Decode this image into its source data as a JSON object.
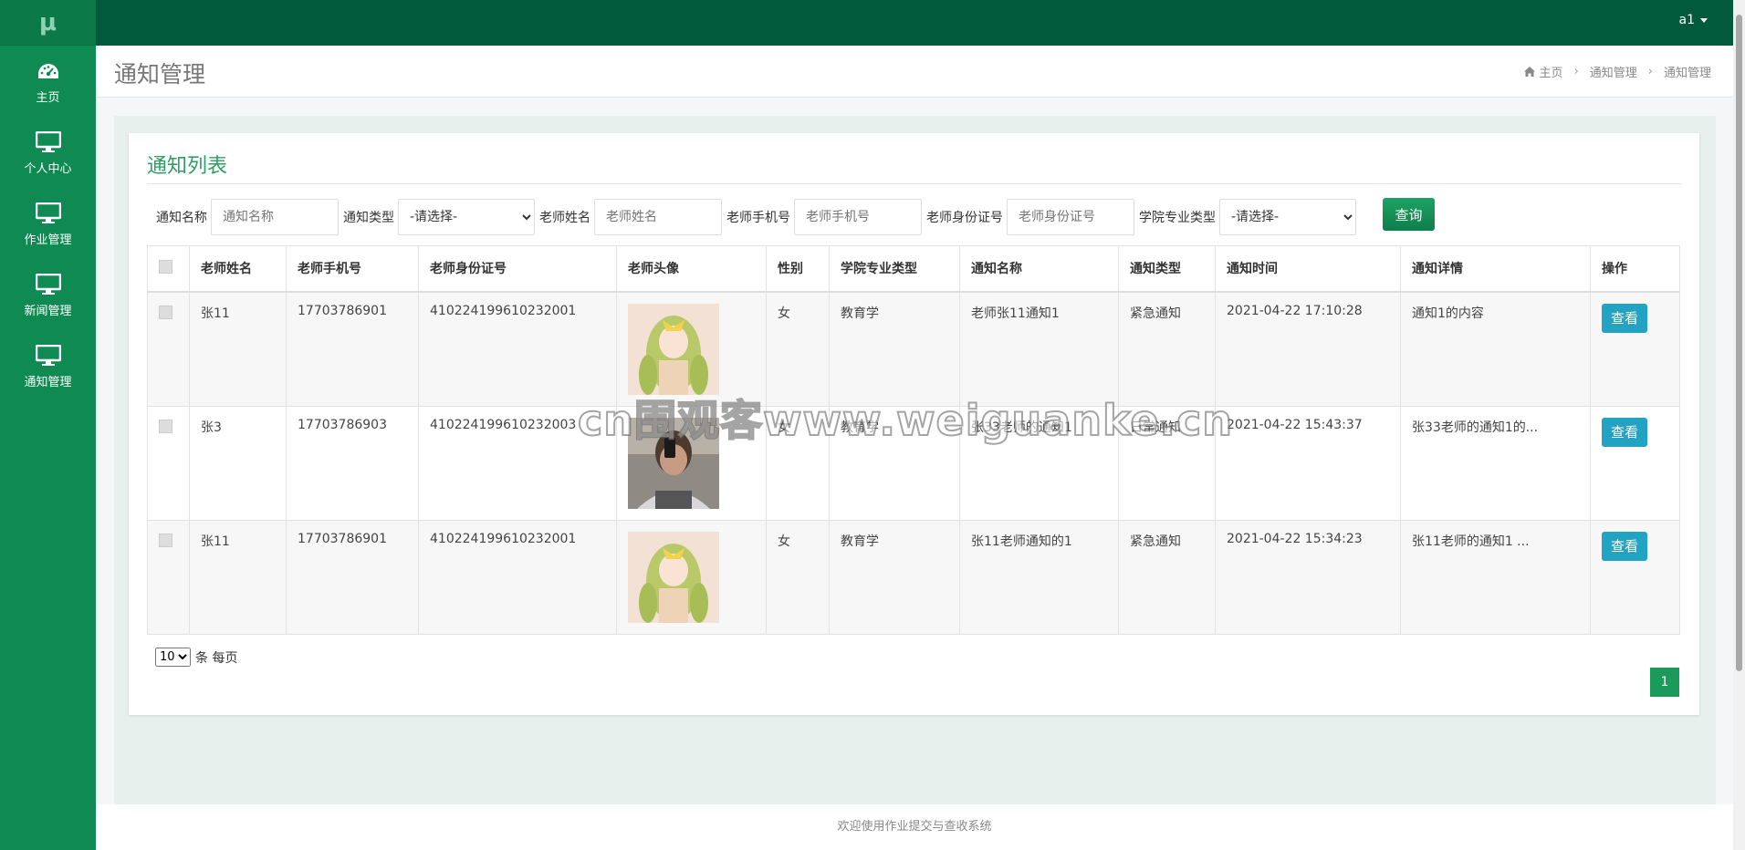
{
  "brand": {
    "logo": "μ"
  },
  "sidebar": {
    "items": [
      {
        "label": "主页",
        "icon": "dashboard-icon"
      },
      {
        "label": "个人中心",
        "icon": "monitor-icon"
      },
      {
        "label": "作业管理",
        "icon": "monitor-icon"
      },
      {
        "label": "新闻管理",
        "icon": "monitor-icon"
      },
      {
        "label": "通知管理",
        "icon": "monitor-icon"
      }
    ]
  },
  "topbar": {
    "user": "a1"
  },
  "header": {
    "title": "通知管理",
    "breadcrumb": [
      "主页",
      "通知管理",
      "通知管理"
    ]
  },
  "card": {
    "title": "通知列表"
  },
  "filters": {
    "notice_name": {
      "label": "通知名称",
      "placeholder": "通知名称"
    },
    "notice_type": {
      "label": "通知类型",
      "selected": "-请选择-"
    },
    "teacher_name": {
      "label": "老师姓名",
      "placeholder": "老师姓名"
    },
    "teacher_phone": {
      "label": "老师手机号",
      "placeholder": "老师手机号"
    },
    "teacher_id": {
      "label": "老师身份证号",
      "placeholder": "老师身份证号"
    },
    "major_type": {
      "label": "学院专业类型",
      "selected": "-请选择-"
    },
    "query_label": "查询"
  },
  "table": {
    "headers": [
      "老师姓名",
      "老师手机号",
      "老师身份证号",
      "老师头像",
      "性别",
      "学院专业类型",
      "通知名称",
      "通知类型",
      "通知时间",
      "通知详情",
      "操作"
    ],
    "rows": [
      {
        "name": "张11",
        "phone": "17703786901",
        "idno": "410224199610232001",
        "avatar": "anime-girl",
        "gender": "女",
        "major": "教育学",
        "notice_name": "老师张11通知1",
        "notice_type": "紧急通知",
        "time": "2021-04-22 17:10:28",
        "detail": "通知1的内容",
        "action": "查看"
      },
      {
        "name": "张3",
        "phone": "17703786903",
        "idno": "410224199610232003",
        "avatar": "selfie",
        "gender": "女",
        "major": "教育学",
        "notice_name": "张33老师的通知1",
        "notice_type": "日常通知",
        "time": "2021-04-22 15:43:37",
        "detail": "张33老师的通知1的...",
        "action": "查看"
      },
      {
        "name": "张11",
        "phone": "17703786901",
        "idno": "410224199610232001",
        "avatar": "anime-girl",
        "gender": "女",
        "major": "教育学",
        "notice_name": "张11老师通知的1",
        "notice_type": "紧急通知",
        "time": "2021-04-22 15:34:23",
        "detail": "张11老师的通知1 ...",
        "action": "查看"
      }
    ]
  },
  "pagination": {
    "page_size": "10",
    "page_size_suffix": "条 每页",
    "current_page": "1"
  },
  "footer": {
    "text": "欢迎使用作业提交与查收系统"
  },
  "watermark": {
    "text": "cn围观客www.weiguanke.cn"
  },
  "colors": {
    "sidebar": "#0e8a52",
    "topbar": "#015a3b",
    "accent": "#2e9e62",
    "view_button": "#22a3c3"
  }
}
